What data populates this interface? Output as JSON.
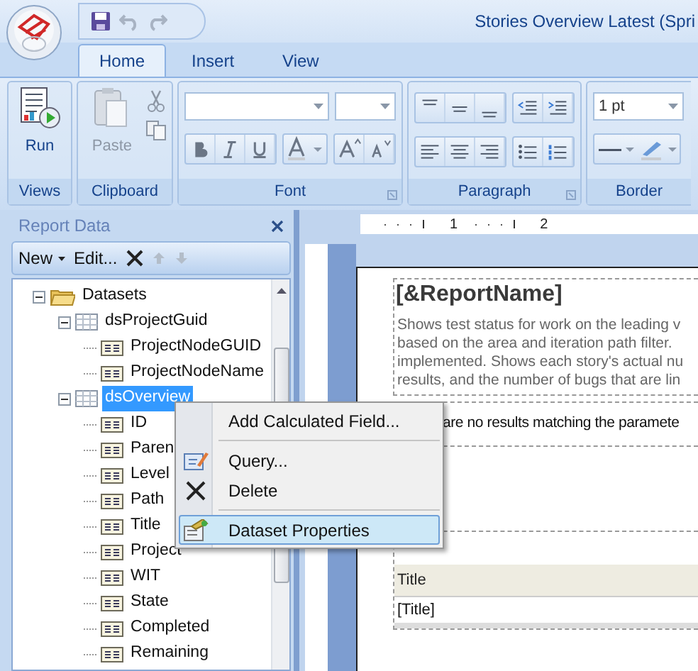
{
  "window": {
    "title": "Stories Overview Latest (Spri"
  },
  "tabs": [
    {
      "label": "Home",
      "selected": true
    },
    {
      "label": "Insert",
      "selected": false
    },
    {
      "label": "View",
      "selected": false
    }
  ],
  "ribbon": {
    "groups": [
      {
        "kind": "views",
        "label": "Views",
        "button": "Run"
      },
      {
        "kind": "clipboard",
        "label": "Clipboard",
        "button": "Paste",
        "disabled": true
      },
      {
        "kind": "font",
        "label": "Font"
      },
      {
        "kind": "paragraph",
        "label": "Paragraph"
      },
      {
        "kind": "border",
        "label": "Border",
        "value": "1 pt"
      }
    ]
  },
  "report_data": {
    "title": "Report Data",
    "toolbar": [
      {
        "kind": "dropdown",
        "label": "New"
      },
      {
        "kind": "button",
        "label": "Edit..."
      }
    ],
    "tree": [
      {
        "kind": "folder",
        "label": "Datasets",
        "expanded": true,
        "selected": false,
        "children": [
          {
            "kind": "dataset",
            "label": "dsProjectGuid",
            "expanded": true,
            "selected": false,
            "children": [
              {
                "kind": "field",
                "label": "ProjectNodeGUID",
                "selected": false
              },
              {
                "kind": "field",
                "label": "ProjectNodeName",
                "selected": false
              }
            ]
          },
          {
            "kind": "dataset",
            "label": "dsOverview",
            "expanded": true,
            "selected": true,
            "children": [
              {
                "kind": "field",
                "label": "ID",
                "selected": false
              },
              {
                "kind": "field",
                "label": "Paren",
                "selected": false
              },
              {
                "kind": "field",
                "label": "Level",
                "selected": false
              },
              {
                "kind": "field",
                "label": "Path",
                "selected": false
              },
              {
                "kind": "field",
                "label": "Title",
                "selected": false
              },
              {
                "kind": "field",
                "label": "Project",
                "selected": false
              },
              {
                "kind": "field",
                "label": "WIT",
                "selected": false
              },
              {
                "kind": "field",
                "label": "State",
                "selected": false
              },
              {
                "kind": "field",
                "label": "Completed",
                "selected": false
              },
              {
                "kind": "field",
                "label": "Remaining",
                "selected": false
              }
            ]
          }
        ]
      }
    ]
  },
  "context_menu": {
    "items": [
      {
        "kind": "item",
        "label": "Add Calculated Field...",
        "selected": false
      },
      {
        "kind": "separator"
      },
      {
        "kind": "item",
        "label": "Query...",
        "selected": false
      },
      {
        "kind": "item",
        "label": "Delete",
        "selected": false
      },
      {
        "kind": "separator"
      },
      {
        "kind": "item",
        "label": "Dataset Properties",
        "selected": true
      }
    ]
  },
  "designer": {
    "ruler": [
      "1",
      "2"
    ],
    "report": {
      "title": "[&ReportName]",
      "description": "Shows test status for work on the leading v\nbased on the area and iteration path filter.\nimplemented. Shows each story's actual nu\nresults, and the number of bugs that are lin",
      "no_results": "are no results matching the paramete",
      "table": {
        "columns": [
          "Title"
        ],
        "rows": [
          [
            "[Title]"
          ]
        ]
      }
    }
  }
}
